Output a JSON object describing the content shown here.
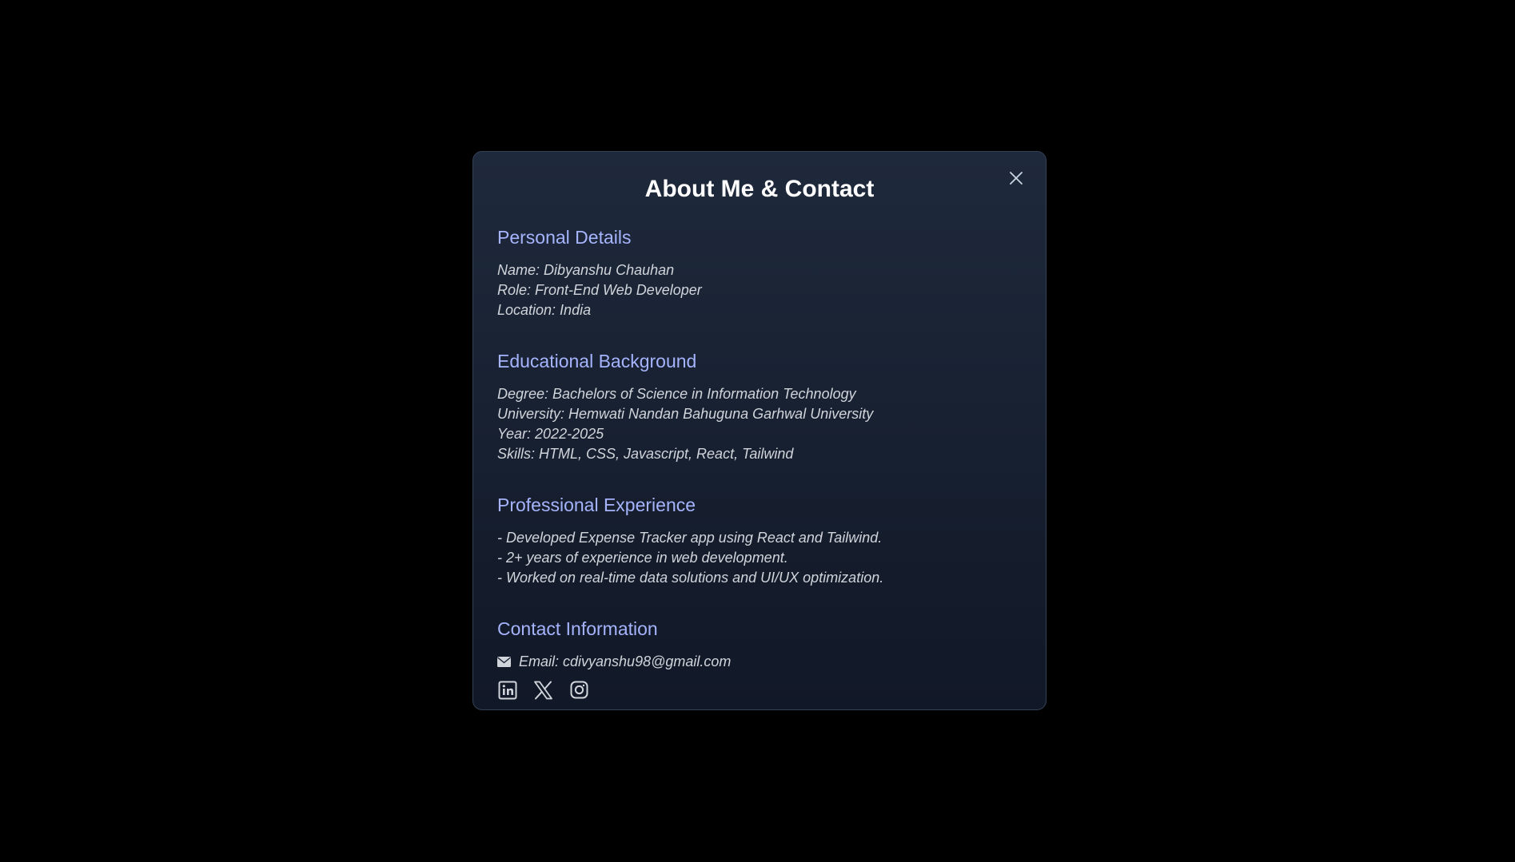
{
  "colors": {
    "overlay": "#000000",
    "modal_top": "#1e293b",
    "modal_bottom": "#111827",
    "heading": "#a5b4fc",
    "body_text": "#d1d5db",
    "title": "#ffffff",
    "icon": "#d1d5db"
  },
  "modal": {
    "title": "About Me & Contact",
    "close_icon": "close-icon"
  },
  "personal": {
    "heading": "Personal Details",
    "lines": [
      "Name: Dibyanshu Chauhan",
      "Role: Front-End Web Developer",
      "Location: India"
    ]
  },
  "education": {
    "heading": "Educational Background",
    "lines": [
      "Degree: Bachelors of Science in Information Technology",
      "University: Hemwati Nandan Bahuguna Garhwal University",
      "Year: 2022-2025",
      "Skills: HTML, CSS, Javascript, React, Tailwind"
    ]
  },
  "experience": {
    "heading": "Professional Experience",
    "lines": [
      "- Developed Expense Tracker app using React and Tailwind.",
      "- 2+ years of experience in web development.",
      "- Worked on real-time data solutions and UI/UX optimization."
    ]
  },
  "contact": {
    "heading": "Contact Information",
    "email_icon": "envelope-icon",
    "email": "Email: cdivyanshu98@gmail.com",
    "socials": [
      "linkedin-icon",
      "x-icon",
      "instagram-icon"
    ]
  }
}
